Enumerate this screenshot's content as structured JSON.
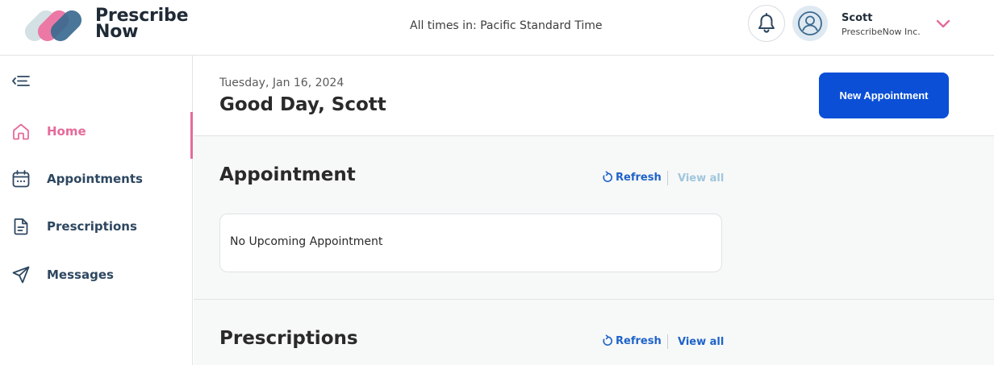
{
  "header": {
    "logo_line1": "Prescribe",
    "logo_line2": "Now",
    "timezone_text": "All times in: Pacific Standard Time",
    "user_name": "Scott",
    "user_org": "PrescribeNow Inc."
  },
  "sidebar": {
    "items": [
      {
        "label": "Home",
        "icon": "home-icon",
        "active": true
      },
      {
        "label": "Appointments",
        "icon": "calendar-icon",
        "active": false
      },
      {
        "label": "Prescriptions",
        "icon": "document-icon",
        "active": false
      },
      {
        "label": "Messages",
        "icon": "paper-plane-icon",
        "active": false
      }
    ]
  },
  "main": {
    "date": "Tuesday, Jan 16, 2024",
    "greeting": "Good Day, Scott",
    "new_appointment_label": "New Appointment",
    "sections": [
      {
        "title": "Appointment",
        "refresh_label": "Refresh",
        "view_all_label": "View all",
        "view_all_enabled": false,
        "empty_text": "No Upcoming Appointment"
      },
      {
        "title": "Prescriptions",
        "refresh_label": "Refresh",
        "view_all_label": "View all",
        "view_all_enabled": true
      }
    ]
  },
  "colors": {
    "accent_pink": "#e56b9b",
    "nav_text": "#2d4760",
    "primary_button": "#0a4fd6",
    "link_blue": "#1e63c9",
    "link_disabled": "#9fc6dc"
  }
}
